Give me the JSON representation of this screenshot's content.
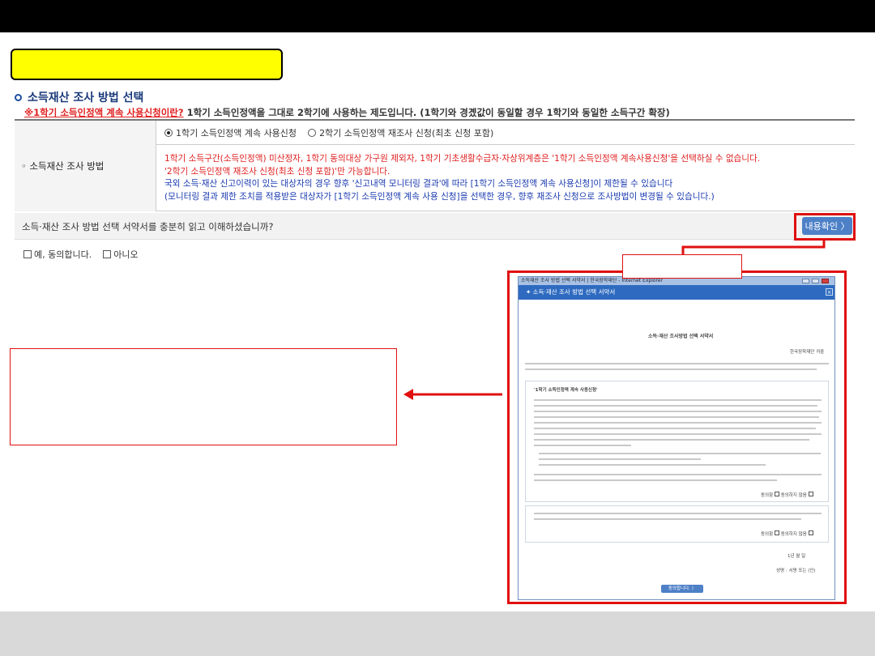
{
  "section": {
    "title": "소득재산 조사 방법 선택",
    "notice_prefix": "※1학기 소득인정액 계속 사용신청이란?",
    "notice_rest": " 1학기 소득인정액을 그대로 2학기에 사용하는 제도입니다. (1학기와 경곘값이 동일할 경우 1학기와 동일한 소득구간 확장)"
  },
  "form": {
    "label": "◦ 소득재산 조사 방법",
    "options": [
      {
        "label": "1학기 소득인정액 계속 사용신청",
        "selected": true
      },
      {
        "label": "2학기 소득인정액 재조사 신청(최초 신청 포함)",
        "selected": false
      }
    ],
    "notes": [
      {
        "text": "1학기 소득구간(소득인정액) 미산정자, 1학기 동의대상 가구원 제외자, 1학기 기초생활수급자·자상위계층은 '1학기 소득인정액 계속사용신청'을 선택하실 수 없습니다.",
        "color": "red"
      },
      {
        "text": "'2학기 소득인정액 재조사 신청(최초 신청 포함)'만 가능합니다.",
        "color": "red"
      },
      {
        "text": "국외 소득·재산 신고이력이 있는 대상자의 경우 향후 '신고내역 모니터링 결과'에 따라 [1학기 소득인정액 계속 사용신청]이 제한될 수 있습니다",
        "color": "blue"
      },
      {
        "text": "(모니터링 결과 제한 조치를 적용받은 대상자가 [1학기 소득인정액 계속 사용 신청]을 선택한 경우, 향후 재조사 신청으로 조사방법이 변경될 수 있습니다.)",
        "color": "blue"
      }
    ]
  },
  "agree": {
    "question": "소득·재산 조사 방법 선택 서약서를 충분히 읽고 이해하셨습니까?",
    "confirm_button": "내용확인 〉",
    "yes_label": "예, 동의합니다.",
    "no_label": "아니오"
  },
  "popup": {
    "ie_title": "소득재산 조사 방법 선택 서약서 | 한국장학재단 - Internet Explorer",
    "header": "✦ 소득·재산 조사 방법 선택 서약서",
    "doc_title": "소득·재산 조사방법 선택 서약서",
    "org": "한국장학재단 귀중",
    "box_title": "'1학기 소득인정액 계속 사용신청'",
    "agree_label": "동의함",
    "disagree_label": "동의하지 않음",
    "date": "1년   월   일",
    "sign": "성명 :        서명 또는 (인)",
    "submit_button": "동의합니다. 〉"
  },
  "colors": {
    "highlight_red": "#e01010",
    "header_blue": "#2e6bc0",
    "button_blue": "#4d80c7",
    "yellow": "#ffff00"
  }
}
